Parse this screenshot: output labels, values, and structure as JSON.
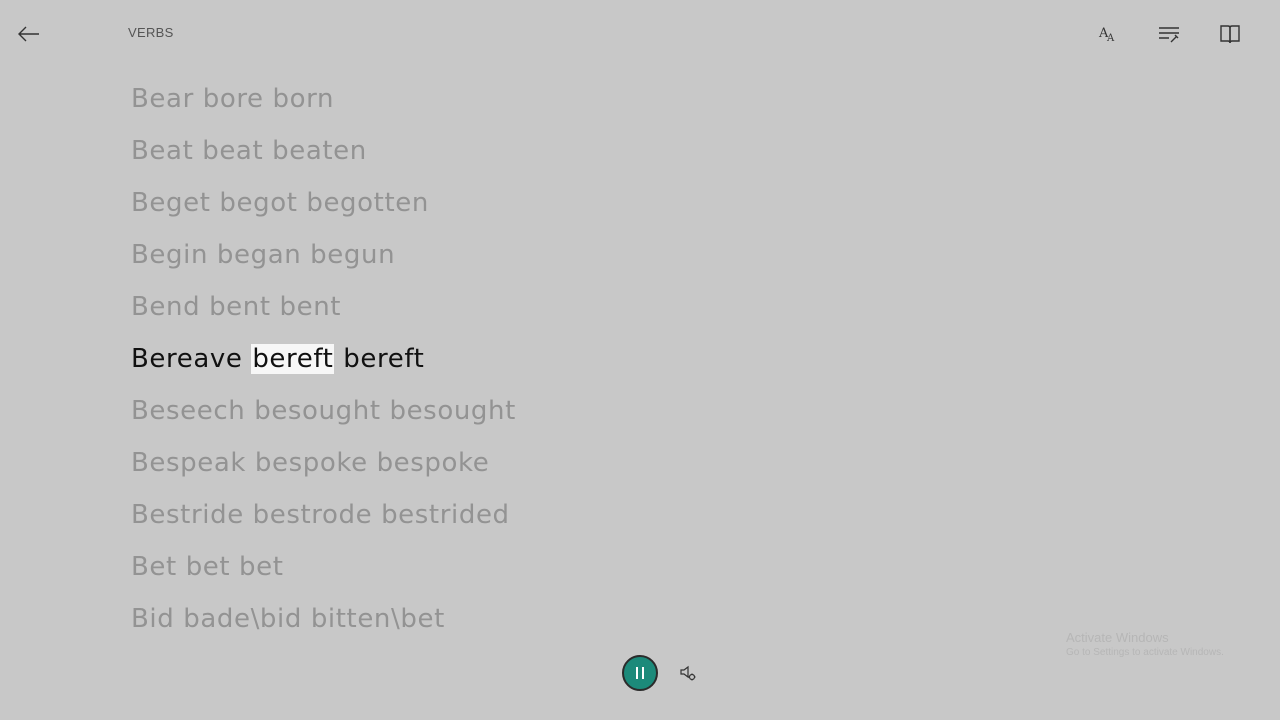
{
  "header": {
    "title": "VERBS"
  },
  "toolbar": {
    "text_options_icon": "text-size-icon",
    "grammar_tools_icon": "grammar-tools-icon",
    "reading_prefs_icon": "book-icon"
  },
  "lines": [
    {
      "text": "Bear bore born",
      "active": false
    },
    {
      "text": "Beat beat beaten",
      "active": false
    },
    {
      "text": "Beget begot begotten",
      "active": false
    },
    {
      "text": "Begin began begun",
      "active": false
    },
    {
      "text": "Bend bent bent",
      "active": false
    },
    {
      "before": "Bereave ",
      "highlight": "bereft",
      "after": " bereft",
      "active": true
    },
    {
      "text": "Beseech besought besought",
      "active": false
    },
    {
      "text": "Bespeak bespoke bespoke",
      "active": false
    },
    {
      "text": "Bestride bestrode bestrided",
      "active": false
    },
    {
      "text": "Bet bet bet",
      "active": false
    },
    {
      "text": "Bid bade\\bid bitten\\bet",
      "active": false
    }
  ],
  "watermark": {
    "title": "Activate Windows",
    "subtitle": "Go to Settings to activate Windows."
  },
  "colors": {
    "background": "#c8c8c8",
    "accent": "#1c8a7a",
    "inactive_text": "#939393",
    "active_text": "#111111"
  }
}
